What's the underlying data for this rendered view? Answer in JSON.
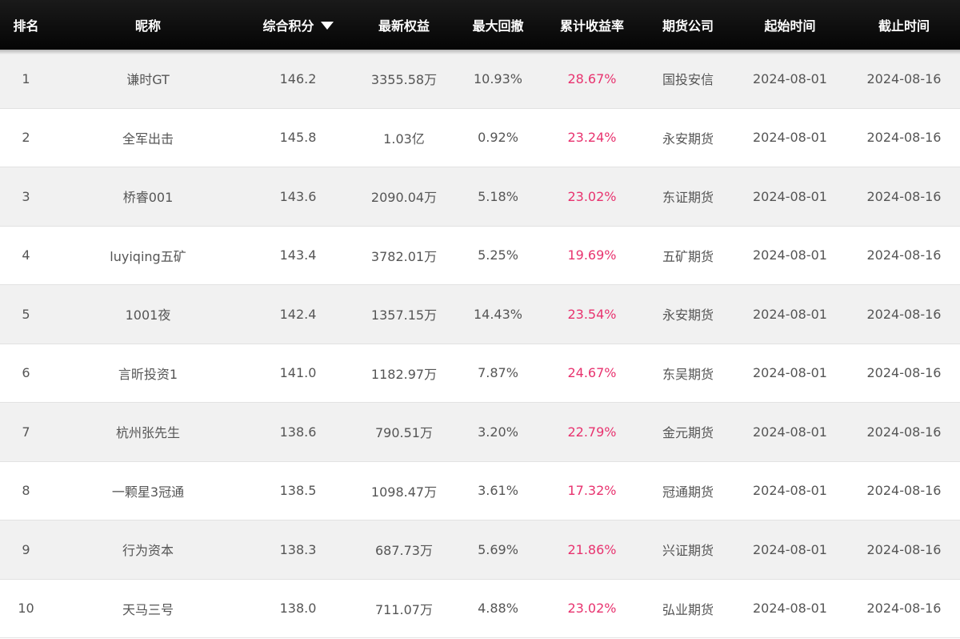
{
  "header": {
    "rank": "排名",
    "name": "昵称",
    "score": "综合积分",
    "equity": "最新权益",
    "drawdown": "最大回撤",
    "return": "累计收益率",
    "firm": "期货公司",
    "start": "起始时间",
    "end": "截止时间",
    "sort_icon": "caret-down-icon"
  },
  "colors": {
    "header_bg": "#0a0a0a",
    "odd_row_bg": "#f1f1f1",
    "return_color": "#e8336f",
    "text_color": "#555555"
  },
  "rows": [
    {
      "rank": "1",
      "name": "谦时GT",
      "score": "146.2",
      "equity": "3355.58万",
      "drawdown": "10.93%",
      "return": "28.67%",
      "firm": "国投安信",
      "start": "2024-08-01",
      "end": "2024-08-16"
    },
    {
      "rank": "2",
      "name": "全军出击",
      "score": "145.8",
      "equity": "1.03亿",
      "drawdown": "0.92%",
      "return": "23.24%",
      "firm": "永安期货",
      "start": "2024-08-01",
      "end": "2024-08-16"
    },
    {
      "rank": "3",
      "name": "桥睿001",
      "score": "143.6",
      "equity": "2090.04万",
      "drawdown": "5.18%",
      "return": "23.02%",
      "firm": "东证期货",
      "start": "2024-08-01",
      "end": "2024-08-16"
    },
    {
      "rank": "4",
      "name": "luyiqing五矿",
      "score": "143.4",
      "equity": "3782.01万",
      "drawdown": "5.25%",
      "return": "19.69%",
      "firm": "五矿期货",
      "start": "2024-08-01",
      "end": "2024-08-16"
    },
    {
      "rank": "5",
      "name": "1001夜",
      "score": "142.4",
      "equity": "1357.15万",
      "drawdown": "14.43%",
      "return": "23.54%",
      "firm": "永安期货",
      "start": "2024-08-01",
      "end": "2024-08-16"
    },
    {
      "rank": "6",
      "name": "言昕投资1",
      "score": "141.0",
      "equity": "1182.97万",
      "drawdown": "7.87%",
      "return": "24.67%",
      "firm": "东吴期货",
      "start": "2024-08-01",
      "end": "2024-08-16"
    },
    {
      "rank": "7",
      "name": "杭州张先生",
      "score": "138.6",
      "equity": "790.51万",
      "drawdown": "3.20%",
      "return": "22.79%",
      "firm": "金元期货",
      "start": "2024-08-01",
      "end": "2024-08-16"
    },
    {
      "rank": "8",
      "name": "一颗星3冠通",
      "score": "138.5",
      "equity": "1098.47万",
      "drawdown": "3.61%",
      "return": "17.32%",
      "firm": "冠通期货",
      "start": "2024-08-01",
      "end": "2024-08-16"
    },
    {
      "rank": "9",
      "name": "行为资本",
      "score": "138.3",
      "equity": "687.73万",
      "drawdown": "5.69%",
      "return": "21.86%",
      "firm": "兴证期货",
      "start": "2024-08-01",
      "end": "2024-08-16"
    },
    {
      "rank": "10",
      "name": "天马三号",
      "score": "138.0",
      "equity": "711.07万",
      "drawdown": "4.88%",
      "return": "23.02%",
      "firm": "弘业期货",
      "start": "2024-08-01",
      "end": "2024-08-16"
    }
  ]
}
